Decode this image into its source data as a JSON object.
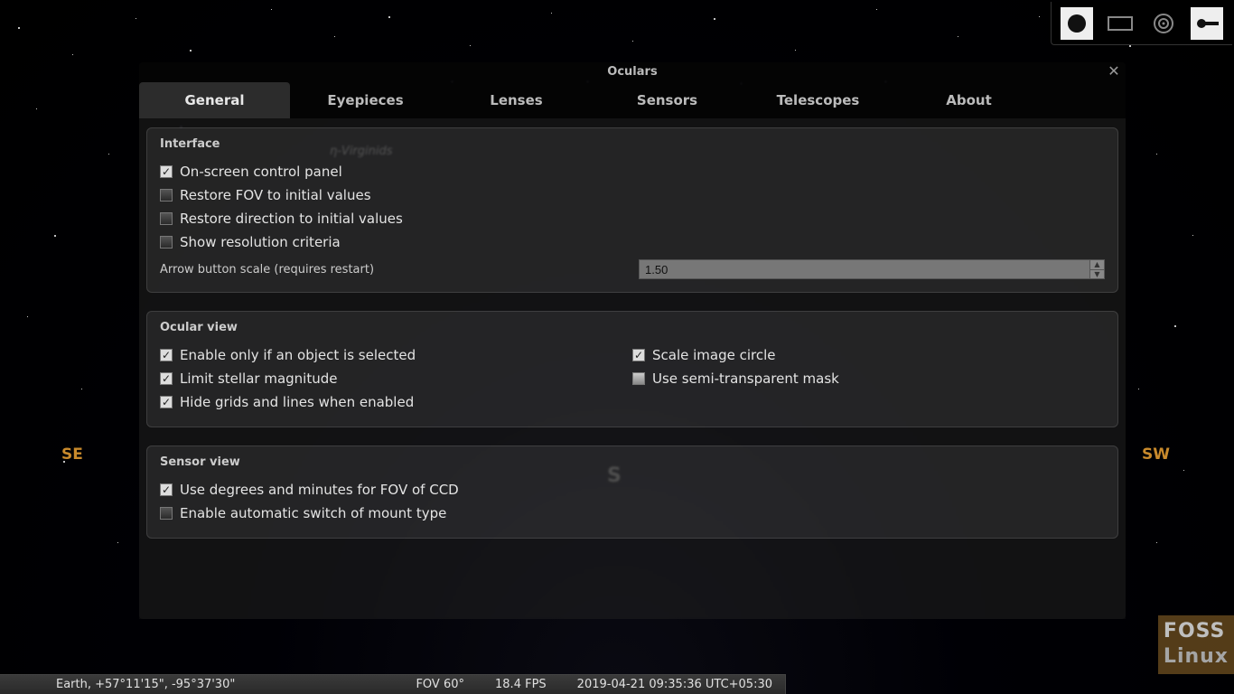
{
  "toolbar": {
    "icons": [
      "circle-icon",
      "rectangle-icon",
      "target-icon",
      "settings-icon"
    ],
    "active": 0,
    "activeAlt": 3
  },
  "dialog": {
    "title": "Oculars",
    "tabs": [
      "General",
      "Eyepieces",
      "Lenses",
      "Sensors",
      "Telescopes",
      "About"
    ],
    "activeTab": 0
  },
  "groups": {
    "interface": {
      "title": "Interface",
      "items": [
        {
          "label": "On-screen control panel",
          "checked": true
        },
        {
          "label": "Restore FOV to initial values",
          "checked": false
        },
        {
          "label": "Restore direction to initial values",
          "checked": false
        },
        {
          "label": "Show resolution criteria",
          "checked": false
        }
      ],
      "arrowScaleLabel": "Arrow button scale (requires restart)",
      "arrowScaleValue": "1.50"
    },
    "ocular": {
      "title": "Ocular view",
      "left": [
        {
          "label": "Enable only if an object is selected",
          "checked": true
        },
        {
          "label": "Limit stellar magnitude",
          "checked": true
        },
        {
          "label": "Hide grids and lines when enabled",
          "checked": true
        }
      ],
      "right": [
        {
          "label": "Scale image circle",
          "checked": true
        },
        {
          "label": "Use semi-transparent mask",
          "checked": false,
          "half": true
        }
      ]
    },
    "sensor": {
      "title": "Sensor view",
      "items": [
        {
          "label": "Use degrees and minutes for FOV of CCD",
          "checked": true
        },
        {
          "label": "Enable automatic switch of mount type",
          "checked": false
        }
      ]
    }
  },
  "compass": {
    "se": "SE",
    "s": "S",
    "sw": "SW"
  },
  "behind": {
    "virginids": "η-Virginids"
  },
  "status": {
    "location": "Earth, +57°11'15\", -95°37'30\"",
    "fov": "FOV 60°",
    "fps": "18.4 FPS",
    "datetime": "2019-04-21 09:35:36 UTC+05:30"
  },
  "watermark": {
    "l1": "FOSS",
    "l2": "Linux"
  }
}
